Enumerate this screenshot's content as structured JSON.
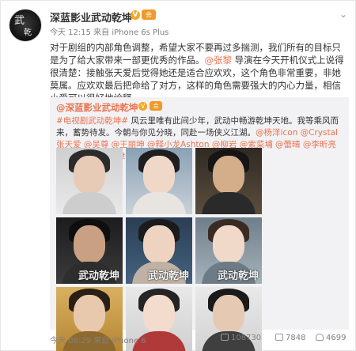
{
  "post": {
    "author": "深蓝影业武动乾坤",
    "v_badge": "V",
    "vip_badge": "会",
    "meta": "今天 12:15 来自 iPhone 6s Plus",
    "text_1": "对于剧组的内部角色调整，希望大家不要再过多揣测，我们所有的目标只是为了给大家带来一部更优秀的作品。",
    "text_at": "@张黎",
    "text_2": " 导演在今天开机仪式上说得很清楚：接触张天爱后觉得她还是适合应欢欢，这个角色非常重要，非她莫属。应欢欢最后把命给了对方，这样的角色需要强大的内心力量，相信小爱可以很好地诠释。",
    "menu_icon": "chevron-down-icon"
  },
  "repost": {
    "author": "@深蓝影业武动乾坤",
    "v_badge": "V",
    "vip_badge": "会",
    "text_tag": "#电视剧武动乾坤#",
    "text_1": " 风云里唯有此间少年，武动中畅游乾坤天地。我等乘风而来，蓄势待发。今朝与你见分晓，同赴一场侠义江湖。",
    "text_ats": "@杨洋icon @Crystal张天爱 @吴尊 @王丽坤 @释小龙Ashton @柳岩 @索菜埔 @蕾晴 @李昕亮 @天蚕土豆 @天津深蓝影业",
    "tile_mark": "武动乾坤",
    "tiles": [
      {
        "name": "poster-1"
      },
      {
        "name": "poster-2"
      },
      {
        "name": "poster-3"
      },
      {
        "name": "poster-4"
      },
      {
        "name": "poster-5"
      },
      {
        "name": "poster-6"
      },
      {
        "name": "poster-7"
      },
      {
        "name": "poster-8"
      },
      {
        "name": "poster-9"
      }
    ],
    "time": "今天 08:29 来自 iPhone 6",
    "reposts": "108730",
    "comments": "7848",
    "likes": "4699"
  },
  "colors": {
    "link": "#eb7350",
    "repost_bg": "#f2f2f5",
    "badge": "#f5a623"
  }
}
